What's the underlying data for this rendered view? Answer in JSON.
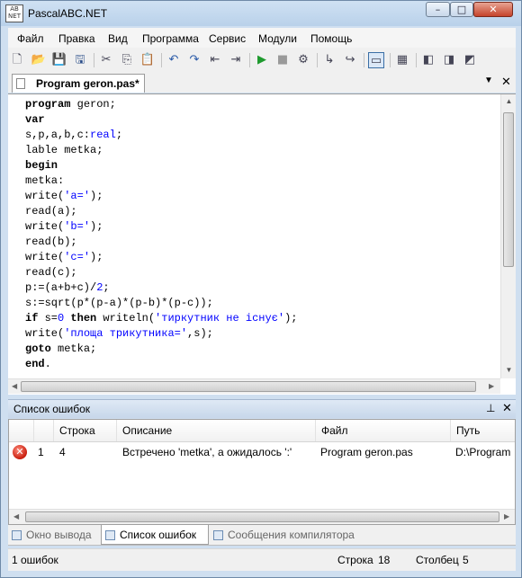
{
  "window": {
    "title": "PascalABC.NET",
    "logo_text": "AB\nNET"
  },
  "window_controls": {
    "minimize": "–",
    "maximize": "□",
    "close": "✕"
  },
  "menu": [
    "Файл",
    "Правка",
    "Вид",
    "Программа",
    "Сервис",
    "Модули",
    "Помощь"
  ],
  "toolbar": {
    "icons": [
      "new-file-icon",
      "open-folder-icon",
      "save-icon",
      "save-all-icon",
      "cut-icon",
      "copy-icon",
      "paste-icon",
      "undo-icon",
      "redo-icon",
      "navigate-back-icon",
      "navigate-forward-icon",
      "run-icon",
      "stop-icon",
      "compile-icon",
      "step-into-icon",
      "step-over-icon",
      "output-window-icon",
      "properties-icon",
      "debug-tool-icon",
      "module-tool-icon",
      "reference-tool-icon"
    ],
    "active": "output-window-icon"
  },
  "editor": {
    "tab_title": "Program geron.pas*",
    "code_lines": [
      [
        [
          "k",
          "program"
        ],
        [
          "i",
          " geron;"
        ]
      ],
      [
        [
          "k",
          "var"
        ]
      ],
      [
        [
          "i",
          "s,p,a,b,c:"
        ],
        [
          "t",
          "real"
        ],
        [
          "i",
          ";"
        ]
      ],
      [
        [
          "i",
          "lable metka;"
        ]
      ],
      [
        [
          "k",
          "begin"
        ]
      ],
      [
        [
          "i",
          "metka:"
        ]
      ],
      [
        [
          "i",
          "write("
        ],
        [
          "s",
          "'a='"
        ],
        [
          "i",
          ");"
        ]
      ],
      [
        [
          "i",
          "read(a);"
        ]
      ],
      [
        [
          "i",
          "write("
        ],
        [
          "s",
          "'b='"
        ],
        [
          "i",
          ");"
        ]
      ],
      [
        [
          "i",
          "read(b);"
        ]
      ],
      [
        [
          "i",
          "write("
        ],
        [
          "s",
          "'c='"
        ],
        [
          "i",
          ");"
        ]
      ],
      [
        [
          "i",
          "read(c);"
        ]
      ],
      [
        [
          "i",
          "p:=(a+b+c)/"
        ],
        [
          "t",
          "2"
        ],
        [
          "i",
          ";"
        ]
      ],
      [
        [
          "i",
          "s:=sqrt(p*(p-a)*(p-b)*(p-c));"
        ]
      ],
      [
        [
          "k",
          "if"
        ],
        [
          "i",
          " s="
        ],
        [
          "t",
          "0"
        ],
        [
          "i",
          " "
        ],
        [
          "k",
          "then"
        ],
        [
          "i",
          " writeln("
        ],
        [
          "s",
          "'тиркутник не існує'"
        ],
        [
          "i",
          ");"
        ]
      ],
      [
        [
          "i",
          "write("
        ],
        [
          "s",
          "'площа трикутника='"
        ],
        [
          "i",
          ",s);"
        ]
      ],
      [
        [
          "k",
          "goto"
        ],
        [
          "i",
          " metka;"
        ]
      ],
      [
        [
          "k",
          "end"
        ],
        [
          "i",
          "."
        ]
      ]
    ]
  },
  "error_panel": {
    "title": "Список ошибок",
    "pin": "⊥",
    "close": "✕",
    "columns": [
      "Строка",
      "Описание",
      "Файл",
      "Путь"
    ],
    "rows": [
      {
        "number": "1",
        "line": "4",
        "description": "Встречено 'metka', а ожидалось ':'",
        "file": "Program geron.pas",
        "path": "D:\\Program"
      }
    ]
  },
  "bottom_tabs": [
    {
      "label": "Окно вывода",
      "active": false
    },
    {
      "label": "Список ошибок",
      "active": true
    },
    {
      "label": "Сообщения компилятора",
      "active": false
    }
  ],
  "status": {
    "errors": "1 ошибок",
    "row_label": "Строка",
    "row_value": "18",
    "col_label": "Столбец",
    "col_value": "5"
  }
}
